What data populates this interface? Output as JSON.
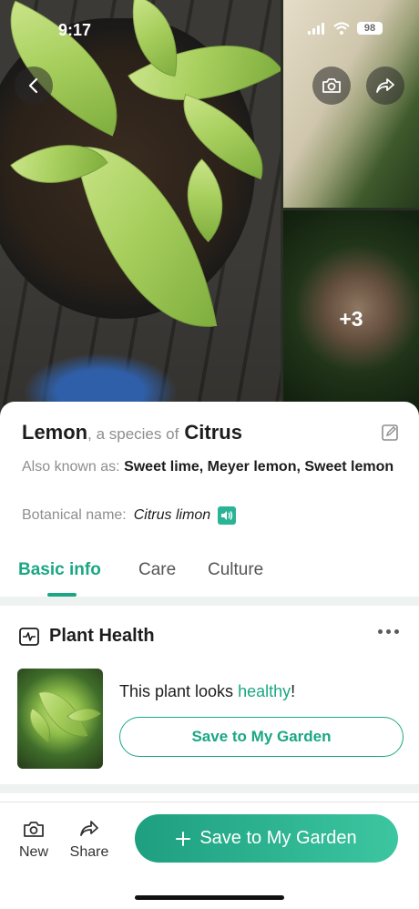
{
  "status_bar": {
    "time": "9:17",
    "battery": "98"
  },
  "gallery": {
    "more_photos": "+3"
  },
  "plant": {
    "common_name": "Lemon",
    "species_connector": ", a species of",
    "genus": "Citrus",
    "aka_label": "Also known as:",
    "aka_values": "Sweet lime, Meyer lemon, Sweet lemon",
    "botanical_label": "Botanical name:",
    "botanical_value": "Citrus limon"
  },
  "tabs": [
    {
      "label": "Basic info",
      "active": true
    },
    {
      "label": "Care",
      "active": false
    },
    {
      "label": "Culture",
      "active": false
    }
  ],
  "health": {
    "title": "Plant Health",
    "status_prefix": "This plant looks",
    "status_value": "healthy",
    "status_suffix": "!",
    "save_button": "Save to My Garden"
  },
  "bottom_bar": {
    "new_label": "New",
    "share_label": "Share",
    "primary_button": "Save to My Garden"
  },
  "colors": {
    "accent": "#1aa784",
    "accent_light": "#3cc6a0",
    "divider": "#eef2f1"
  },
  "icons": [
    "back-icon",
    "camera-icon",
    "share-icon",
    "edit-icon",
    "speaker-icon",
    "pulse-icon",
    "more-icon",
    "plus-icon",
    "signal-icon",
    "wifi-icon"
  ]
}
